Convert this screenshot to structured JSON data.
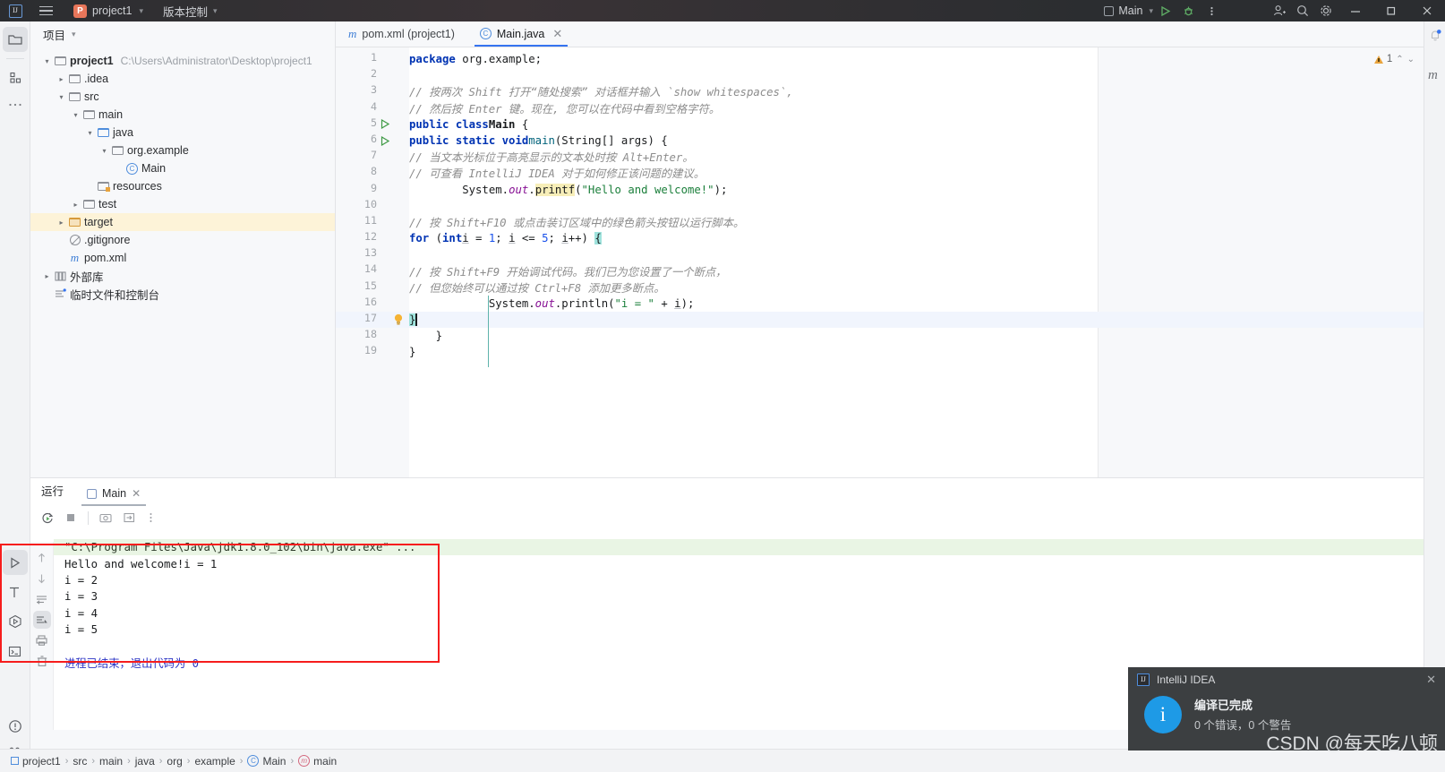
{
  "titlebar": {
    "menu_icon": "hamburger-icon",
    "project_name": "project1",
    "project_badge": "P",
    "vcs_label": "版本控制",
    "run_config": "Main",
    "run_icon": "run-icon",
    "debug_icon": "debug-icon",
    "more_icon": "more-vertical-icon",
    "share_icon": "add-user-icon",
    "search_icon": "search-icon",
    "settings_icon": "gear-icon",
    "minimize": "–",
    "maximize": "❐",
    "close": "✕"
  },
  "rail": {
    "project_icon": "folder-icon",
    "structure_icon": "structure-icon",
    "more_icon": "ellipsis-icon",
    "run_icon": "run-icon",
    "build_icon": "hammer-icon",
    "debug_icon": "debug-icon",
    "terminal_icon": "terminal-icon",
    "problems_icon": "problems-icon",
    "vcs_icon": "git-branch-icon"
  },
  "project_panel": {
    "title": "项目",
    "tree": [
      {
        "label": "project1",
        "sub": "C:\\Users\\Administrator\\Desktop\\project1",
        "indent": 0,
        "arrow": "v",
        "icon": "module-icon",
        "bold": true,
        "highlight": false
      },
      {
        "label": ".idea",
        "sub": "",
        "indent": 1,
        "arrow": ">",
        "icon": "folder-icon",
        "bold": false,
        "highlight": false
      },
      {
        "label": "src",
        "sub": "",
        "indent": 1,
        "arrow": "v",
        "icon": "folder-icon",
        "bold": false,
        "highlight": false
      },
      {
        "label": "main",
        "sub": "",
        "indent": 2,
        "arrow": "v",
        "icon": "folder-icon",
        "bold": false,
        "highlight": false
      },
      {
        "label": "java",
        "sub": "",
        "indent": 3,
        "arrow": "v",
        "icon": "source-folder-icon",
        "bold": false,
        "highlight": false
      },
      {
        "label": "org.example",
        "sub": "",
        "indent": 4,
        "arrow": "v",
        "icon": "package-icon",
        "bold": false,
        "highlight": false
      },
      {
        "label": "Main",
        "sub": "",
        "indent": 5,
        "arrow": "",
        "icon": "java-class-icon",
        "bold": false,
        "highlight": false
      },
      {
        "label": "resources",
        "sub": "",
        "indent": 3,
        "arrow": "",
        "icon": "resources-folder-icon",
        "bold": false,
        "highlight": false
      },
      {
        "label": "test",
        "sub": "",
        "indent": 2,
        "arrow": ">",
        "icon": "folder-icon",
        "bold": false,
        "highlight": false
      },
      {
        "label": "target",
        "sub": "",
        "indent": 1,
        "arrow": ">",
        "icon": "target-folder-icon",
        "bold": false,
        "highlight": true
      },
      {
        "label": ".gitignore",
        "sub": "",
        "indent": 1,
        "arrow": "",
        "icon": "gitignore-icon",
        "bold": false,
        "highlight": false
      },
      {
        "label": "pom.xml",
        "sub": "",
        "indent": 1,
        "arrow": "",
        "icon": "maven-icon",
        "bold": false,
        "highlight": false
      },
      {
        "label": "外部库",
        "sub": "",
        "indent": 0,
        "arrow": ">",
        "icon": "library-icon",
        "bold": false,
        "highlight": false
      },
      {
        "label": "临时文件和控制台",
        "sub": "",
        "indent": 0,
        "arrow": "",
        "icon": "scratches-icon",
        "bold": false,
        "highlight": false
      }
    ]
  },
  "editor": {
    "tabs": [
      {
        "label": "pom.xml (project1)",
        "icon": "maven-icon",
        "active": false,
        "closable": false
      },
      {
        "label": "Main.java",
        "icon": "java-class-icon",
        "active": true,
        "closable": true
      }
    ],
    "tab_more_icon": "more-vertical-icon",
    "inspection": {
      "warning_count": "1",
      "up": "⌃",
      "down": "⌄"
    },
    "lines": [
      {
        "n": "1",
        "gutter": "",
        "bulb": false,
        "current": false
      },
      {
        "n": "2",
        "gutter": "",
        "bulb": false,
        "current": false
      },
      {
        "n": "3",
        "gutter": "",
        "bulb": false,
        "current": false
      },
      {
        "n": "4",
        "gutter": "",
        "bulb": false,
        "current": false
      },
      {
        "n": "5",
        "gutter": "run",
        "bulb": false,
        "current": false
      },
      {
        "n": "6",
        "gutter": "run",
        "bulb": false,
        "current": false
      },
      {
        "n": "7",
        "gutter": "",
        "bulb": false,
        "current": false
      },
      {
        "n": "8",
        "gutter": "",
        "bulb": false,
        "current": false
      },
      {
        "n": "9",
        "gutter": "",
        "bulb": false,
        "current": false
      },
      {
        "n": "10",
        "gutter": "",
        "bulb": false,
        "current": false
      },
      {
        "n": "11",
        "gutter": "",
        "bulb": false,
        "current": false
      },
      {
        "n": "12",
        "gutter": "",
        "bulb": false,
        "current": false
      },
      {
        "n": "13",
        "gutter": "",
        "bulb": false,
        "current": false
      },
      {
        "n": "14",
        "gutter": "",
        "bulb": false,
        "current": false
      },
      {
        "n": "15",
        "gutter": "",
        "bulb": false,
        "current": false
      },
      {
        "n": "16",
        "gutter": "",
        "bulb": false,
        "current": false
      },
      {
        "n": "17",
        "gutter": "",
        "bulb": true,
        "current": true
      },
      {
        "n": "18",
        "gutter": "",
        "bulb": false,
        "current": false
      },
      {
        "n": "19",
        "gutter": "",
        "bulb": false,
        "current": false
      }
    ],
    "source_text": [
      "package org.example;",
      "",
      "// 按两次 Shift 打开“随处搜索”对话框并输入 `show whitespaces`,",
      "// 然后按 Enter 键。现在，您可以在代码中看到空格字符。",
      "public class Main {",
      "    public static void main(String[] args) {",
      "        // 当文本光标位于高亮显示的文本处时按 Alt+Enter。",
      "        // 可查看 IntelliJ IDEA 对于如何修正该问题的建议。",
      "        System.out.printf(\"Hello and welcome!\");",
      "",
      "        // 按 Shift+F10 或点击装订区域中的绿色箭头按钮以运行脚本。",
      "        for (int i = 1; i <= 5; i++) {",
      "",
      "            // 按 Shift+F9 开始调试代码。我们已为您设置了一个断点，",
      "            // 但您始终可以通过按 Ctrl+F8 添加更多断点。",
      "            System.out.println(\"i = \" + i);",
      "        }",
      "    }",
      "}"
    ]
  },
  "run_panel": {
    "title": "运行",
    "tab_label": "Main",
    "tab_icon": "run-config-icon",
    "tab_close": "✕",
    "toolbar": [
      {
        "name": "rerun-icon"
      },
      {
        "name": "stop-icon"
      },
      {
        "name": "camera-icon"
      },
      {
        "name": "export-icon"
      },
      {
        "name": "more-vertical-icon"
      }
    ],
    "gutter_icons": [
      {
        "name": "scroll-up-icon"
      },
      {
        "name": "scroll-down-icon"
      },
      {
        "name": "soft-wrap-icon"
      },
      {
        "name": "scroll-to-end-icon"
      },
      {
        "name": "print-icon"
      },
      {
        "name": "clear-all-icon"
      }
    ],
    "console": [
      {
        "text": "\"C:\\Program Files\\Java\\jdk1.8.0_102\\bin\\java.exe\" ...",
        "style": "cmdpath"
      },
      {
        "text": "Hello and welcome!i = 1",
        "style": "plain"
      },
      {
        "text": "i = 2",
        "style": "plain"
      },
      {
        "text": "i = 3",
        "style": "plain"
      },
      {
        "text": "i = 4",
        "style": "plain"
      },
      {
        "text": "i = 5",
        "style": "plain"
      },
      {
        "text": "",
        "style": "plain"
      },
      {
        "text": "进程已结束，退出代码为 0",
        "style": "exitmsg"
      }
    ],
    "annotation_color": "#f61d1d"
  },
  "statusbar": {
    "crumbs": [
      {
        "label": "project1",
        "icon": "module-icon"
      },
      {
        "label": "src",
        "icon": ""
      },
      {
        "label": "main",
        "icon": ""
      },
      {
        "label": "java",
        "icon": ""
      },
      {
        "label": "org",
        "icon": ""
      },
      {
        "label": "example",
        "icon": ""
      },
      {
        "label": "Main",
        "icon": "java-class-icon"
      },
      {
        "label": "main",
        "icon": "java-method-icon"
      }
    ],
    "separator": "›"
  },
  "right_rail": {
    "maven_label": "m",
    "notification_icon": "bell-icon"
  },
  "notification": {
    "app": "IntelliJ IDEA",
    "close": "✕",
    "icon": "info-icon",
    "title": "编译已完成",
    "detail": "0 个错误，0 个警告"
  },
  "watermark": {
    "text": "CSDN @每天吃八顿"
  }
}
